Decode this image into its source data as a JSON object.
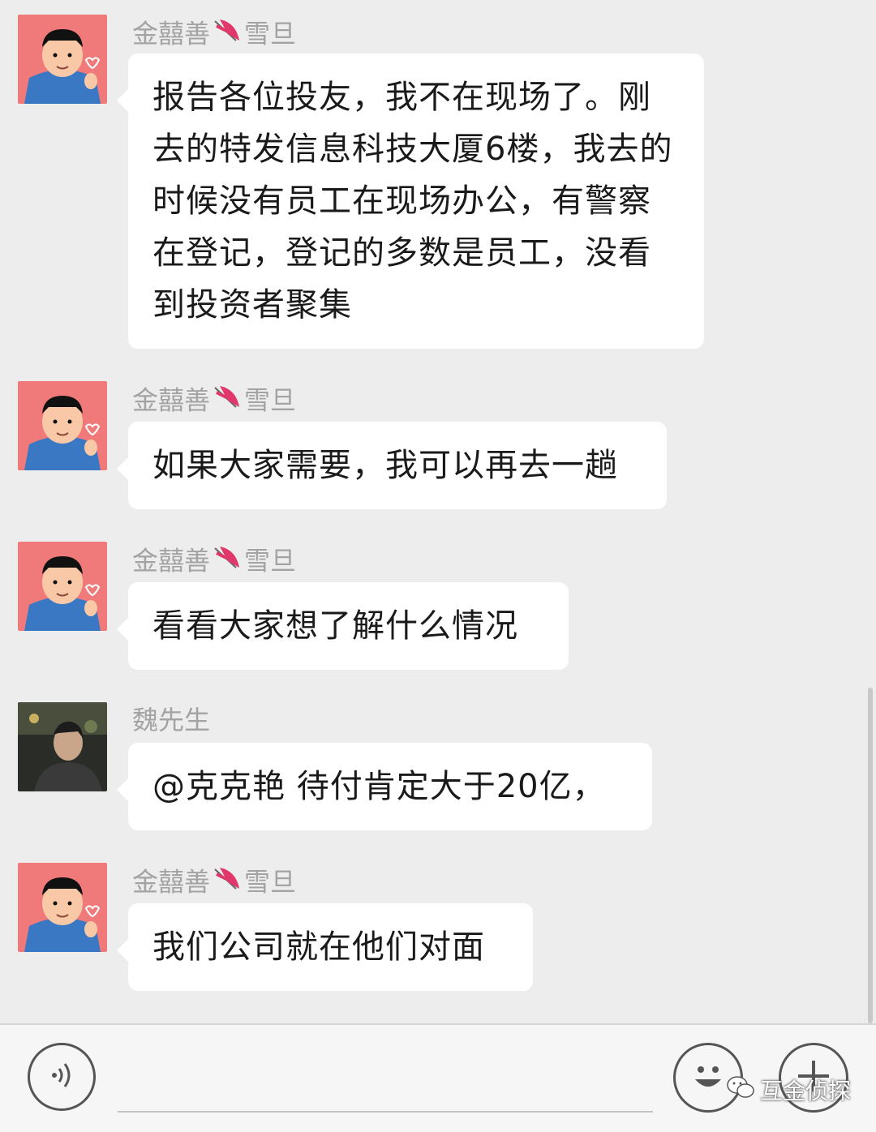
{
  "messages": [
    {
      "sender": "金囍善",
      "sender_suffix": "雪旦",
      "text": "报告各位投友，我不在现场了。刚去的特发信息科技大厦6楼，我去的时候没有员工在现场办公，有警察在登记，登记的多数是员工，没看到投资者聚集",
      "avatar": "cartoon-avatar"
    },
    {
      "sender": "金囍善",
      "sender_suffix": "雪旦",
      "text": "如果大家需要，我可以再去一趟",
      "avatar": "cartoon-avatar"
    },
    {
      "sender": "金囍善",
      "sender_suffix": "雪旦",
      "text": "看看大家想了解什么情况",
      "avatar": "cartoon-avatar"
    },
    {
      "sender": "魏先生",
      "sender_suffix": "",
      "text": "@克克艳  待付肯定大于20亿，",
      "avatar": "photo-avatar"
    },
    {
      "sender": "金囍善",
      "sender_suffix": "雪旦",
      "text": "我们公司就在他们对面",
      "avatar": "cartoon-avatar"
    }
  ],
  "input_bar": {
    "voice_icon": "voice-icon",
    "emoji_icon": "emoji-icon",
    "plus_icon": "plus-icon"
  },
  "watermark": {
    "text": "互金侦探"
  },
  "colors": {
    "background": "#ededed",
    "bubble": "#ffffff",
    "sender": "#a3a3a3",
    "avatar_bg": "#f07a7a"
  }
}
